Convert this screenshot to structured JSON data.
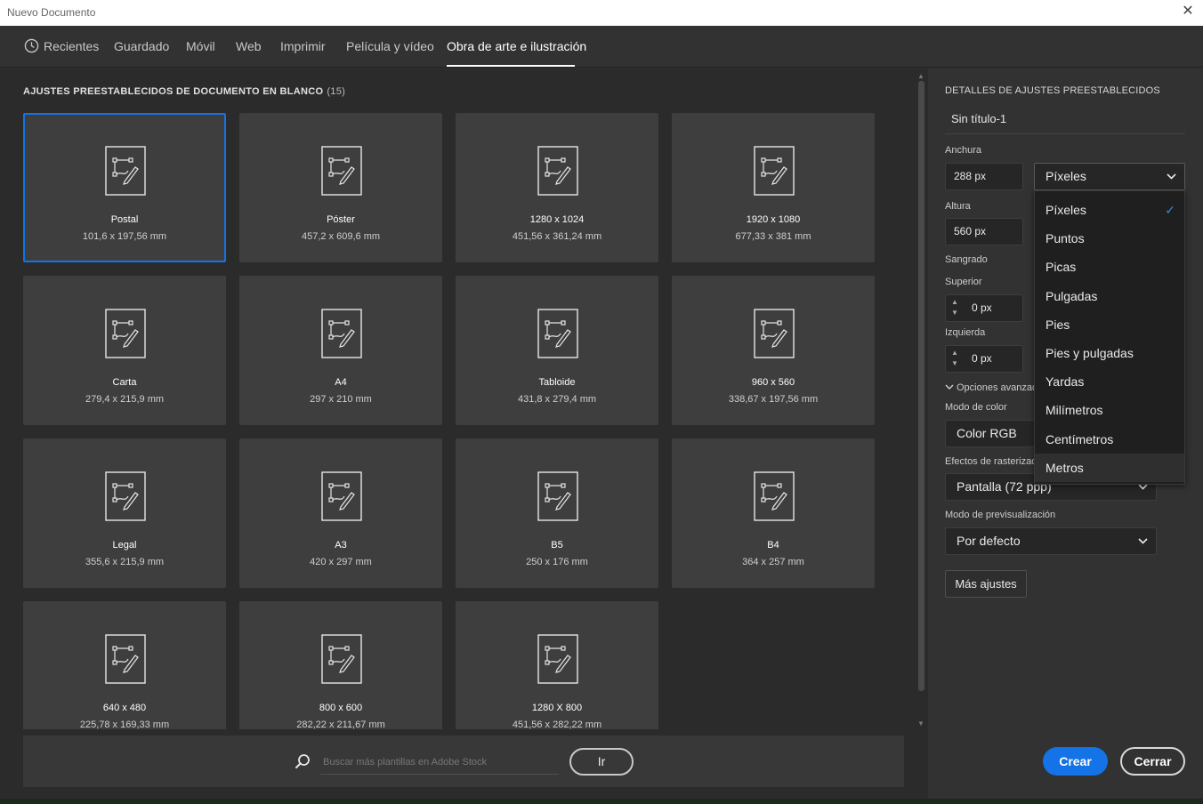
{
  "window": {
    "title": "Nuevo Documento",
    "close_glyph": "✕"
  },
  "tabs": [
    {
      "label": "Recientes",
      "icon": "clock-icon"
    },
    {
      "label": "Guardado"
    },
    {
      "label": "Móvil"
    },
    {
      "label": "Web"
    },
    {
      "label": "Imprimir"
    },
    {
      "label": "Película y vídeo"
    },
    {
      "label": "Obra de arte e ilustración",
      "active": true
    }
  ],
  "presets": {
    "section_title": "AJUSTES PREESTABLECIDOS DE DOCUMENTO EN BLANCO",
    "count": "(15)",
    "items": [
      {
        "name": "Postal",
        "size": "101,6 x 197,56 mm",
        "selected": true
      },
      {
        "name": "Póster",
        "size": "457,2 x 609,6 mm"
      },
      {
        "name": "1280 x 1024",
        "size": "451,56 x 361,24 mm"
      },
      {
        "name": "1920 x 1080",
        "size": "677,33 x 381 mm"
      },
      {
        "name": "Carta",
        "size": "279,4 x 215,9 mm"
      },
      {
        "name": "A4",
        "size": "297 x 210 mm"
      },
      {
        "name": "Tabloide",
        "size": "431,8 x 279,4 mm"
      },
      {
        "name": "960 x 560",
        "size": "338,67 x 197,56 mm"
      },
      {
        "name": "Legal",
        "size": "355,6 x 215,9 mm"
      },
      {
        "name": "A3",
        "size": "420 x 297 mm"
      },
      {
        "name": "B5",
        "size": "250 x 176 mm"
      },
      {
        "name": "B4",
        "size": "364 x 257 mm"
      },
      {
        "name": "640 x 480",
        "size": "225,78 x 169,33 mm"
      },
      {
        "name": "800 x 600",
        "size": "282,22 x 211,67 mm"
      },
      {
        "name": "1280 X 800",
        "size": "451,56 x 282,22 mm"
      }
    ]
  },
  "stock": {
    "placeholder": "Buscar más plantillas en Adobe Stock",
    "go_label": "Ir"
  },
  "details": {
    "title": "DETALLES DE AJUSTES PREESTABLECIDOS",
    "doc_name": "Sin título-1",
    "width_label": "Anchura",
    "width_value": "288 px",
    "units_value": "Píxeles",
    "height_label": "Altura",
    "height_value": "560 px",
    "bleed_label": "Sangrado",
    "top_label": "Superior",
    "top_value": "0 px",
    "left_label": "Izquierda",
    "left_value": "0 px",
    "advanced_label": "Opciones avanzadas",
    "color_mode_label": "Modo de color",
    "color_mode_value": "Color RGB",
    "raster_label": "Efectos de rasterizado",
    "raster_value": "Pantalla (72 ppp)",
    "preview_label": "Modo de previsualización",
    "preview_value": "Por defecto",
    "more_label": "Más ajustes"
  },
  "units_dropdown": {
    "options": [
      "Píxeles",
      "Puntos",
      "Picas",
      "Pulgadas",
      "Pies",
      "Pies y pulgadas",
      "Yardas",
      "Milímetros",
      "Centímetros",
      "Metros"
    ],
    "selected": "Píxeles",
    "check_glyph": "✓"
  },
  "actions": {
    "create_label": "Crear",
    "cancel_label": "Cerrar"
  },
  "colors": {
    "accent": "#1473e6",
    "panel": "#323232",
    "card": "#3e3e3e",
    "background": "#2b2b2b"
  }
}
